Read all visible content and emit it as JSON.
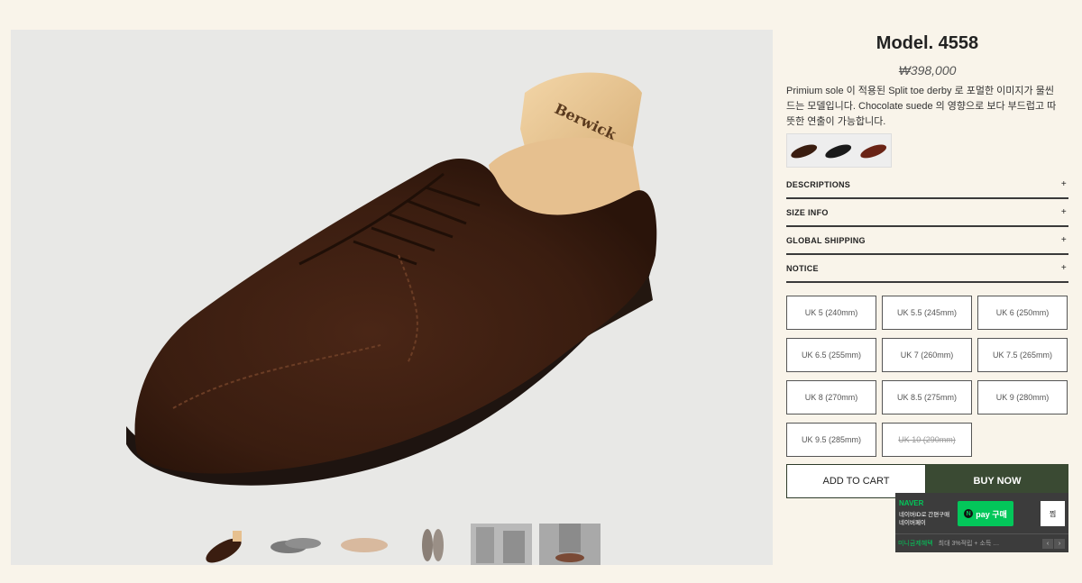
{
  "product": {
    "title": "Model. 4558",
    "price": "₩398,000",
    "description": " Primium sole 이 적용된 Split toe derby 로 포멀한 이미지가 물씬 드는 모델입니다. Chocolate suede 의 영향으로 보다 부드럽고 따뜻한 연출이 가능합니다."
  },
  "gallery": {
    "shoe_tree_brand": "Berwick",
    "thumbnails": [
      "brown suede shoe",
      "grey suede shoe pair",
      "tan sole",
      "shoe pair top view",
      "styled photo",
      "styled photo grey"
    ]
  },
  "color_swatches": [
    "brown",
    "black",
    "burgundy"
  ],
  "accordion": [
    {
      "label": "DESCRIPTIONS",
      "icon": "+"
    },
    {
      "label": "SIZE INFO",
      "icon": "+"
    },
    {
      "label": "GLOBAL SHIPPING",
      "icon": "+"
    },
    {
      "label": "NOTICE",
      "icon": "+"
    }
  ],
  "sizes": [
    {
      "label": "UK 5 (240mm)",
      "soldout": false
    },
    {
      "label": "UK 5.5 (245mm)",
      "soldout": false
    },
    {
      "label": "UK 6 (250mm)",
      "soldout": false
    },
    {
      "label": "UK 6.5 (255mm)",
      "soldout": false
    },
    {
      "label": "UK 7 (260mm)",
      "soldout": false
    },
    {
      "label": "UK 7.5 (265mm)",
      "soldout": false
    },
    {
      "label": "UK 8 (270mm)",
      "soldout": false
    },
    {
      "label": "UK 8.5 (275mm)",
      "soldout": false
    },
    {
      "label": "UK 9 (280mm)",
      "soldout": false
    },
    {
      "label": "UK 9.5 (285mm)",
      "soldout": false
    },
    {
      "label": "UK 10 (290mm)",
      "soldout": true
    }
  ],
  "actions": {
    "add_to_cart": "ADD TO CART",
    "buy_now": "BUY NOW"
  },
  "naver_pay": {
    "brand": "NAVER",
    "line1": "네이버ID로 간편구매",
    "line2": "네이버페이",
    "pay_label": "pay 구매",
    "pay_icon": "N",
    "wish_label": "찜",
    "promo": "미니금제혜택",
    "promo_detail": "최대 3%적립 + 소득 …",
    "prev": "‹",
    "next": "›"
  },
  "colors": {
    "background": "#f9f4ea",
    "gallery_bg": "#e8e8e6",
    "buy_button": "#3a4a33",
    "naver_green": "#03c75a"
  }
}
